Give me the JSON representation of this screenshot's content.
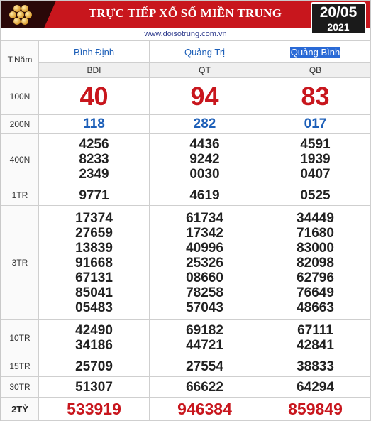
{
  "header": {
    "title": "TRỰC TIẾP XỔ SỐ MIỀN TRUNG",
    "date_day": "20/05",
    "date_year": "2021",
    "website": "www.doisotrung.com.vn"
  },
  "table": {
    "corner_label": "T.Năm",
    "provinces": [
      {
        "name": "Bình Định",
        "code": "BDI"
      },
      {
        "name": "Quảng Trị",
        "code": "QT"
      },
      {
        "name": "Quảng Bình",
        "code": "QB"
      }
    ],
    "prizes": {
      "p100n": {
        "label": "100N",
        "values": [
          "40",
          "94",
          "83"
        ]
      },
      "p200n": {
        "label": "200N",
        "values": [
          "118",
          "282",
          "017"
        ]
      },
      "p400n": {
        "label": "400N",
        "values": [
          [
            "4256",
            "8233",
            "2349"
          ],
          [
            "4436",
            "9242",
            "0030"
          ],
          [
            "4591",
            "1939",
            "0407"
          ]
        ]
      },
      "p1tr": {
        "label": "1TR",
        "values": [
          "9771",
          "4619",
          "0525"
        ]
      },
      "p3tr": {
        "label": "3TR",
        "values": [
          [
            "17374",
            "27659",
            "13839",
            "91668",
            "67131",
            "85041",
            "05483"
          ],
          [
            "61734",
            "17342",
            "40996",
            "25326",
            "08660",
            "78258",
            "57043"
          ],
          [
            "34449",
            "71680",
            "83000",
            "82098",
            "62796",
            "76649",
            "48663"
          ]
        ]
      },
      "p10tr": {
        "label": "10TR",
        "values": [
          [
            "42490",
            "34186"
          ],
          [
            "69182",
            "44721"
          ],
          [
            "67111",
            "42841"
          ]
        ]
      },
      "p15tr": {
        "label": "15TR",
        "values": [
          "25709",
          "27554",
          "38833"
        ]
      },
      "p30tr": {
        "label": "30TR",
        "values": [
          "51307",
          "66622",
          "64294"
        ]
      },
      "p2ty": {
        "label": "2TỶ",
        "values": [
          "533919",
          "946384",
          "859849"
        ]
      }
    }
  },
  "colors": {
    "header_red": "#c8161d",
    "number_red": "#c8161d",
    "number_blue": "#1d5fb8",
    "date_box": "#1a1a1a"
  }
}
